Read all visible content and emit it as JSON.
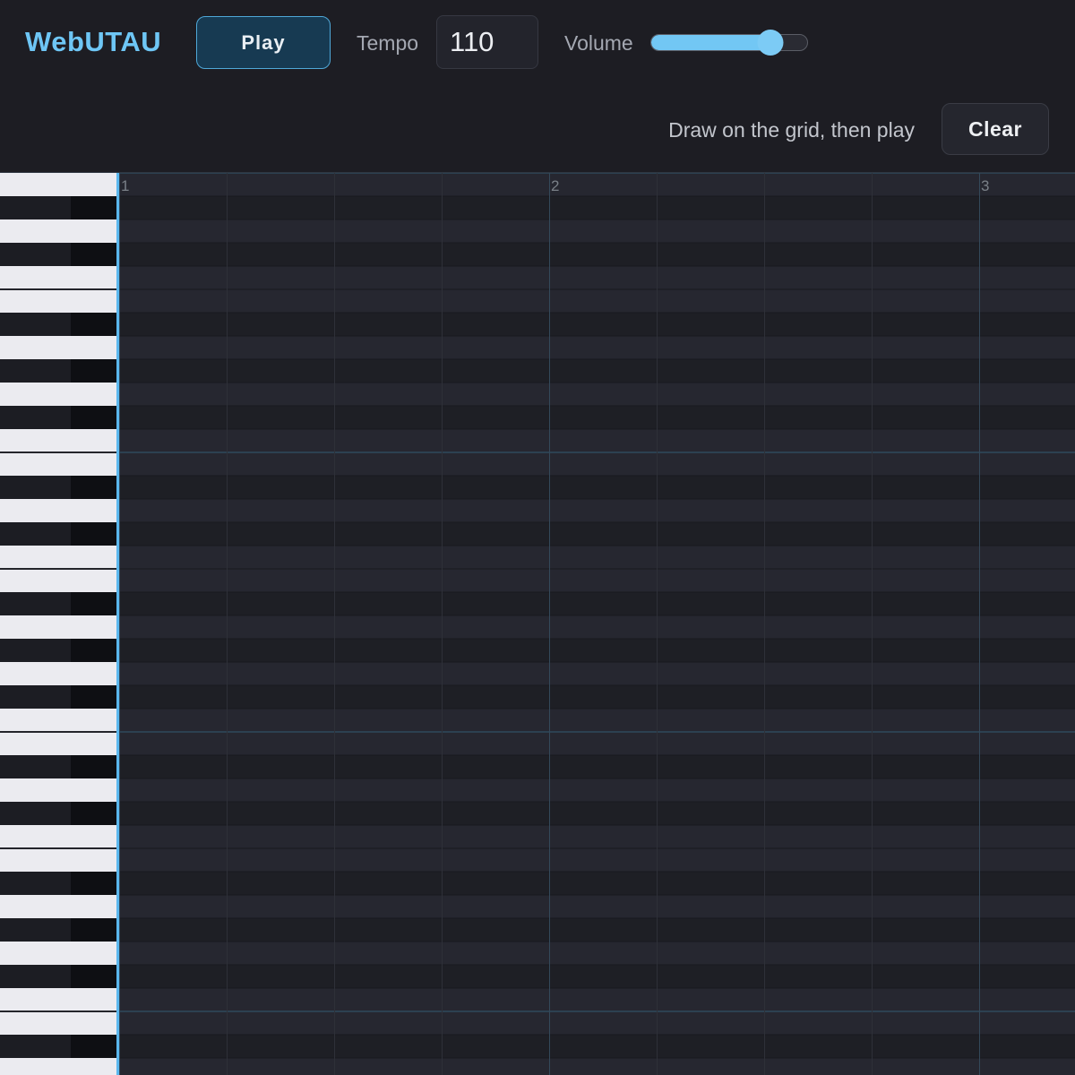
{
  "app": {
    "title": "WebUTAU"
  },
  "toolbar": {
    "play_label": "Play",
    "tempo_label": "Tempo",
    "tempo_value": "110",
    "volume_label": "Volume",
    "volume_level": 0.76,
    "hint": "Draw on the grid, then play",
    "clear_label": "Clear"
  },
  "colors": {
    "accent": "#6ec6f5",
    "background": "#1d1d23",
    "play_button_bg": "#173a52",
    "play_button_border": "#4fa8d8",
    "white_key": "#ebebf0",
    "black_key": "#1c1d23",
    "grid_row_light": "#262730",
    "grid_row_dark": "#1e1f25"
  },
  "piano_roll": {
    "measure_labels": [
      "1",
      "2",
      "3"
    ],
    "beats_per_measure": 4,
    "pitch_rows_visible": 39,
    "black_key_pattern": [
      false,
      true,
      false,
      true,
      false,
      false,
      true,
      false,
      true,
      false,
      true,
      false
    ],
    "notes": []
  }
}
